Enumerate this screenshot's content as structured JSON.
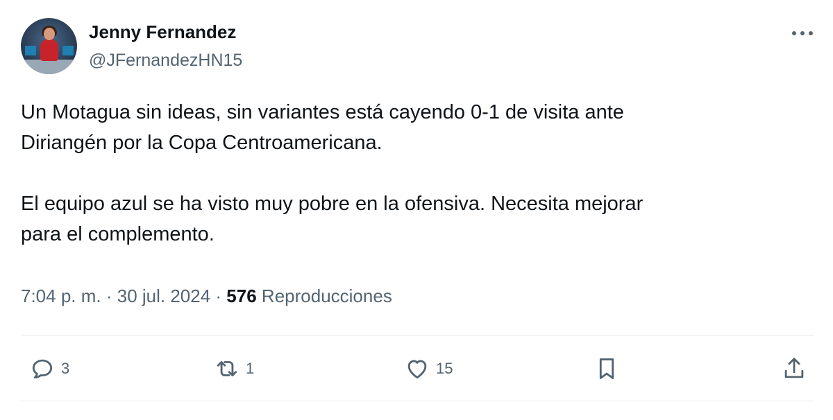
{
  "tweet": {
    "author_name": "Jenny Fernandez",
    "author_handle": "@JFernandezHN15",
    "text": "Un Motagua sin ideas, sin variantes está cayendo 0-1 de visita ante\nDiriangén por la Copa Centroamericana.\n\nEl equipo azul se ha visto muy pobre en la ofensiva. Necesita mejorar\npara el complemento.",
    "time": "7:04 p. m.",
    "separator": " · ",
    "date": "30 jul. 2024",
    "views_count": "576",
    "views_label": "Reproducciones"
  },
  "actions": {
    "replies": "3",
    "retweets": "1",
    "likes": "15"
  },
  "icons": {
    "more": "more-horizontal-icon",
    "reply": "reply-icon",
    "retweet": "retweet-icon",
    "like": "heart-icon",
    "bookmark": "bookmark-icon",
    "share": "share-icon"
  },
  "colors": {
    "text_primary": "#0f1419",
    "text_secondary": "#536471",
    "divider": "#e6ecf0"
  }
}
